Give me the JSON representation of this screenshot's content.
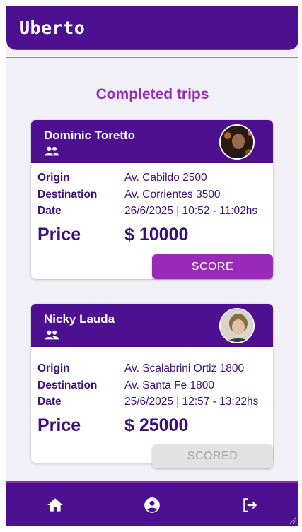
{
  "app": {
    "title": "Uberto"
  },
  "section_title": "Completed trips",
  "labels": {
    "origin": "Origin",
    "destination": "Destination",
    "date": "Date",
    "price": "Price"
  },
  "trips": [
    {
      "driver": "Dominic Toretto",
      "origin": "Av. Cabildo 2500",
      "destination": "Av. Corrientes 3500",
      "date": "26/6/2025 | 10:52 - 11:02hs",
      "price": "$ 10000",
      "button": "SCORE",
      "button_state": "enabled"
    },
    {
      "driver": "Nicky Lauda",
      "origin": "Av. Scalabrini Ortiz 1800",
      "destination": "Av. Santa Fe 1800",
      "date": "25/6/2025 | 12:57 - 13:22hs",
      "price": "$ 25000",
      "button": "SCORED",
      "button_state": "disabled"
    }
  ],
  "nav": {
    "items": [
      "home-icon",
      "account-circle-icon",
      "logout-icon"
    ]
  },
  "colors": {
    "primary": "#4d1091",
    "accent": "#9a2bb8",
    "background": "#f1f0f6",
    "disabled": "#e2e2e2"
  }
}
